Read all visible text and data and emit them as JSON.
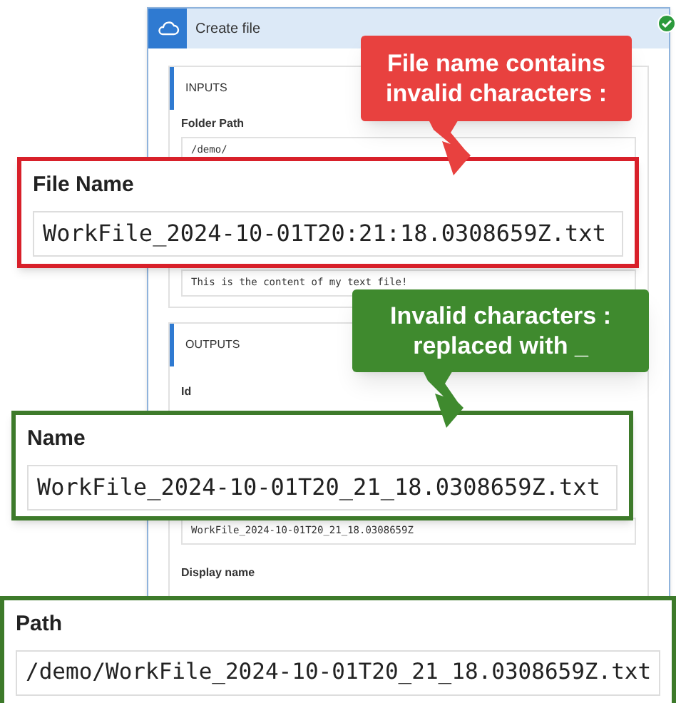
{
  "window": {
    "title": "Create file"
  },
  "inputs": {
    "heading": "INPUTS",
    "fields": [
      {
        "label": "Folder Path",
        "value": "/demo/"
      },
      {
        "value": "This is the content of my text file!"
      }
    ]
  },
  "outputs": {
    "heading": "OUTPUTS",
    "fields": [
      {
        "label": "Id"
      },
      {
        "value": "WorkFile_2024-10-01T20_21_18.0308659Z"
      },
      {
        "label": "Display name"
      }
    ]
  },
  "callouts": [
    {
      "kind": "error",
      "lines": [
        "File name contains",
        "invalid characters :"
      ]
    },
    {
      "kind": "success",
      "lines": [
        "Invalid characters :",
        "replaced with _"
      ]
    }
  ],
  "highlights": [
    {
      "kind": "error",
      "label": "File Name",
      "value": "WorkFile_2024-10-01T20:21:18.0308659Z.txt"
    },
    {
      "kind": "success",
      "label": "Name",
      "value": "WorkFile_2024-10-01T20_21_18.0308659Z.txt"
    },
    {
      "kind": "success",
      "label": "Path",
      "value": "/demo/WorkFile_2024-10-01T20_21_18.0308659Z.txt"
    }
  ]
}
